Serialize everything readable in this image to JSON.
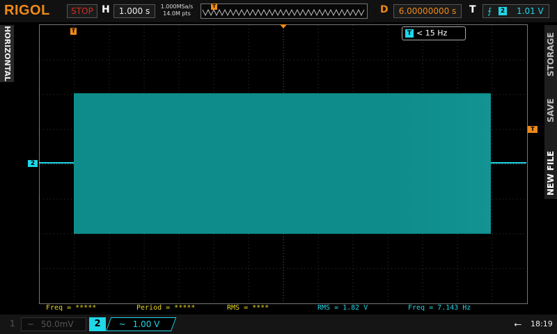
{
  "brand": "RIGOL",
  "run_state": "STOP",
  "horizontal": {
    "label": "H",
    "timebase": "1.000 s",
    "sample_rate": "1.000MSa/s",
    "memory_depth": "14.0M pts"
  },
  "delay": {
    "label": "D",
    "value": "6.00000000 s"
  },
  "trigger": {
    "label": "T",
    "edge_icon": "rising-edge-icon",
    "source": "2",
    "level": "1.01 V",
    "freq_readout": "< 15 Hz",
    "marker": "T"
  },
  "side_tab": {
    "label": "HORIZONTAL"
  },
  "right_menu": {
    "items": [
      "STORAGE",
      "SAVE",
      "NEW FILE"
    ]
  },
  "channel_marker": "2",
  "measurements": [
    {
      "text": "Freq = *****",
      "color": "#e8d820"
    },
    {
      "text": "Period = *****",
      "color": "#e8d820"
    },
    {
      "text": "RMS = ****",
      "color": "#e8d820"
    },
    {
      "text": "RMS = 1.82 V",
      "color": "#1fd7e8"
    },
    {
      "text": "Freq = 7.143 Hz",
      "color": "#1fd7e8"
    }
  ],
  "channels": {
    "ch1": {
      "number": "1",
      "coupling": "~",
      "scale": "50.0mV",
      "active": false
    },
    "ch2": {
      "number": "2",
      "coupling": "~",
      "scale": "1.00 V",
      "active": true
    }
  },
  "status": {
    "usb_icon": "usb-icon",
    "time": "18:19"
  },
  "colors": {
    "brand": "#f08a18",
    "channel2": "#1fd7e8",
    "waveform_fill": "#0e8c8c",
    "stop": "#d03020",
    "measure_inactive": "#e8d820"
  }
}
